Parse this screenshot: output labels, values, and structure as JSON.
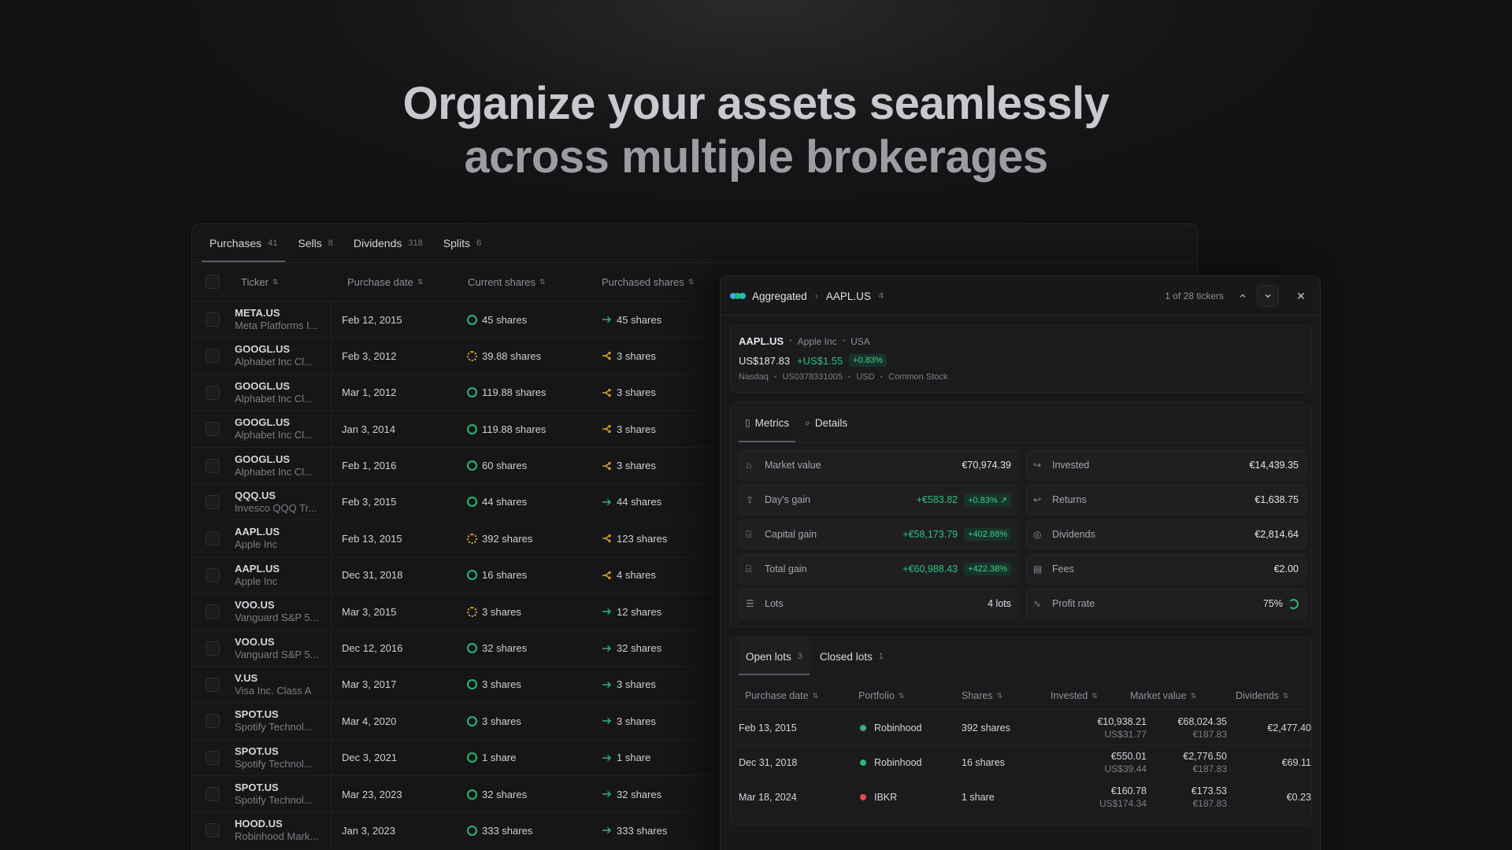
{
  "hero": {
    "line1": "Organize your assets seamlessly",
    "line2": "across multiple brokerages"
  },
  "tabs": [
    {
      "label": "Purchases",
      "count": "41"
    },
    {
      "label": "Sells",
      "count": "8"
    },
    {
      "label": "Dividends",
      "count": "318"
    },
    {
      "label": "Splits",
      "count": "6"
    }
  ],
  "columns": {
    "ticker": "Ticker",
    "purchase_date": "Purchase date",
    "current_shares": "Current shares",
    "purchased_shares": "Purchased shares"
  },
  "rows": [
    {
      "symbol": "META.US",
      "name": "Meta Platforms I...",
      "date": "Feb 12, 2015",
      "current": "45 shares",
      "purchased": "45 shares"
    },
    {
      "symbol": "GOOGL.US",
      "name": "Alphabet Inc Cl...",
      "date": "Feb 3, 2012",
      "current": "39.88 shares",
      "purchased": "3 shares"
    },
    {
      "symbol": "GOOGL.US",
      "name": "Alphabet Inc Cl...",
      "date": "Mar 1, 2012",
      "current": "119.88 shares",
      "purchased": "3 shares"
    },
    {
      "symbol": "GOOGL.US",
      "name": "Alphabet Inc Cl...",
      "date": "Jan 3, 2014",
      "current": "119.88 shares",
      "purchased": "3 shares"
    },
    {
      "symbol": "GOOGL.US",
      "name": "Alphabet Inc Cl...",
      "date": "Feb 1, 2016",
      "current": "60 shares",
      "purchased": "3 shares"
    },
    {
      "symbol": "QQQ.US",
      "name": "Invesco QQQ Tr...",
      "date": "Feb 3, 2015",
      "current": "44 shares",
      "purchased": "44 shares"
    },
    {
      "symbol": "AAPL.US",
      "name": "Apple Inc",
      "date": "Feb 13, 2015",
      "current": "392 shares",
      "purchased": "123 shares"
    },
    {
      "symbol": "AAPL.US",
      "name": "Apple Inc",
      "date": "Dec 31, 2018",
      "current": "16 shares",
      "purchased": "4 shares"
    },
    {
      "symbol": "VOO.US",
      "name": "Vanguard S&P 5...",
      "date": "Mar 3, 2015",
      "current": "3 shares",
      "purchased": "12 shares"
    },
    {
      "symbol": "VOO.US",
      "name": "Vanguard S&P 5...",
      "date": "Dec 12, 2016",
      "current": "32 shares",
      "purchased": "32 shares"
    },
    {
      "symbol": "V.US",
      "name": "Visa Inc. Class A",
      "date": "Mar 3, 2017",
      "current": "3 shares",
      "purchased": "3 shares"
    },
    {
      "symbol": "SPOT.US",
      "name": "Spotify Technol...",
      "date": "Mar 4, 2020",
      "current": "3 shares",
      "purchased": "3 shares"
    },
    {
      "symbol": "SPOT.US",
      "name": "Spotify Technol...",
      "date": "Dec 3, 2021",
      "current": "1 share",
      "purchased": "1 share"
    },
    {
      "symbol": "SPOT.US",
      "name": "Spotify Technol...",
      "date": "Mar 23, 2023",
      "current": "32 shares",
      "purchased": "32 shares"
    },
    {
      "symbol": "HOOD.US",
      "name": "Robinhood Mark...",
      "date": "Jan 3, 2023",
      "current": "333 shares",
      "purchased": "333 shares"
    }
  ],
  "detail": {
    "breadcrumb_root": "Aggregated",
    "breadcrumb_ticker": "AAPL.US",
    "breadcrumb_count": "4",
    "pager": "1 of 28 tickers",
    "symbol": "AAPL.US",
    "company": "Apple Inc",
    "country": "USA",
    "price": "US$187.83",
    "change": "+US$1.55",
    "change_pct": "+0.83%",
    "exchange": "Nasdaq",
    "isin": "US0378331005",
    "currency": "USD",
    "asset_type": "Common Stock",
    "tab_metrics": "Metrics",
    "tab_details": "Details",
    "metrics": {
      "market_value_label": "Market value",
      "market_value": "€70,974.39",
      "invested_label": "Invested",
      "invested": "€14,439.35",
      "days_gain_label": "Day's gain",
      "days_gain": "+€583.82",
      "days_gain_pct": "+0.83% ↗",
      "returns_label": "Returns",
      "returns": "€1,638.75",
      "capital_gain_label": "Capital gain",
      "capital_gain": "+€58,173.79",
      "capital_gain_pct": "+402.88%",
      "dividends_label": "Dividends",
      "dividends": "€2,814.64",
      "total_gain_label": "Total gain",
      "total_gain": "+€60,988.43",
      "total_gain_pct": "+422.38%",
      "fees_label": "Fees",
      "fees": "€2.00",
      "lots_label": "Lots",
      "lots": "4 lots",
      "profit_rate_label": "Profit rate",
      "profit_rate": "75%"
    },
    "lots_tabs": [
      {
        "label": "Open lots",
        "count": "3"
      },
      {
        "label": "Closed lots",
        "count": "1"
      }
    ],
    "lots_columns": {
      "date": "Purchase date",
      "portfolio": "Portfolio",
      "shares": "Shares",
      "invested": "Invested",
      "market_value": "Market value",
      "dividends": "Dividends"
    },
    "lots": [
      {
        "date": "Feb 13, 2015",
        "portfolio": "Robinhood",
        "color": "#2bb673",
        "shares": "392 shares",
        "invested": "€10,938.21",
        "invested_sub": "US$31.77",
        "market": "€68,024.35",
        "market_sub": "€187.83",
        "dividends": "€2,477.40"
      },
      {
        "date": "Dec 31, 2018",
        "portfolio": "Robinhood",
        "color": "#2bb673",
        "shares": "16 shares",
        "invested": "€550.01",
        "invested_sub": "US$39.44",
        "market": "€2,776.50",
        "market_sub": "€187.83",
        "dividends": "€69.11"
      },
      {
        "date": "Mar 18, 2024",
        "portfolio": "IBKR",
        "color": "#e5484d",
        "shares": "1 share",
        "invested": "€160.78",
        "invested_sub": "US$174.34",
        "market": "€173.53",
        "market_sub": "€187.83",
        "dividends": "€0.23"
      }
    ]
  }
}
